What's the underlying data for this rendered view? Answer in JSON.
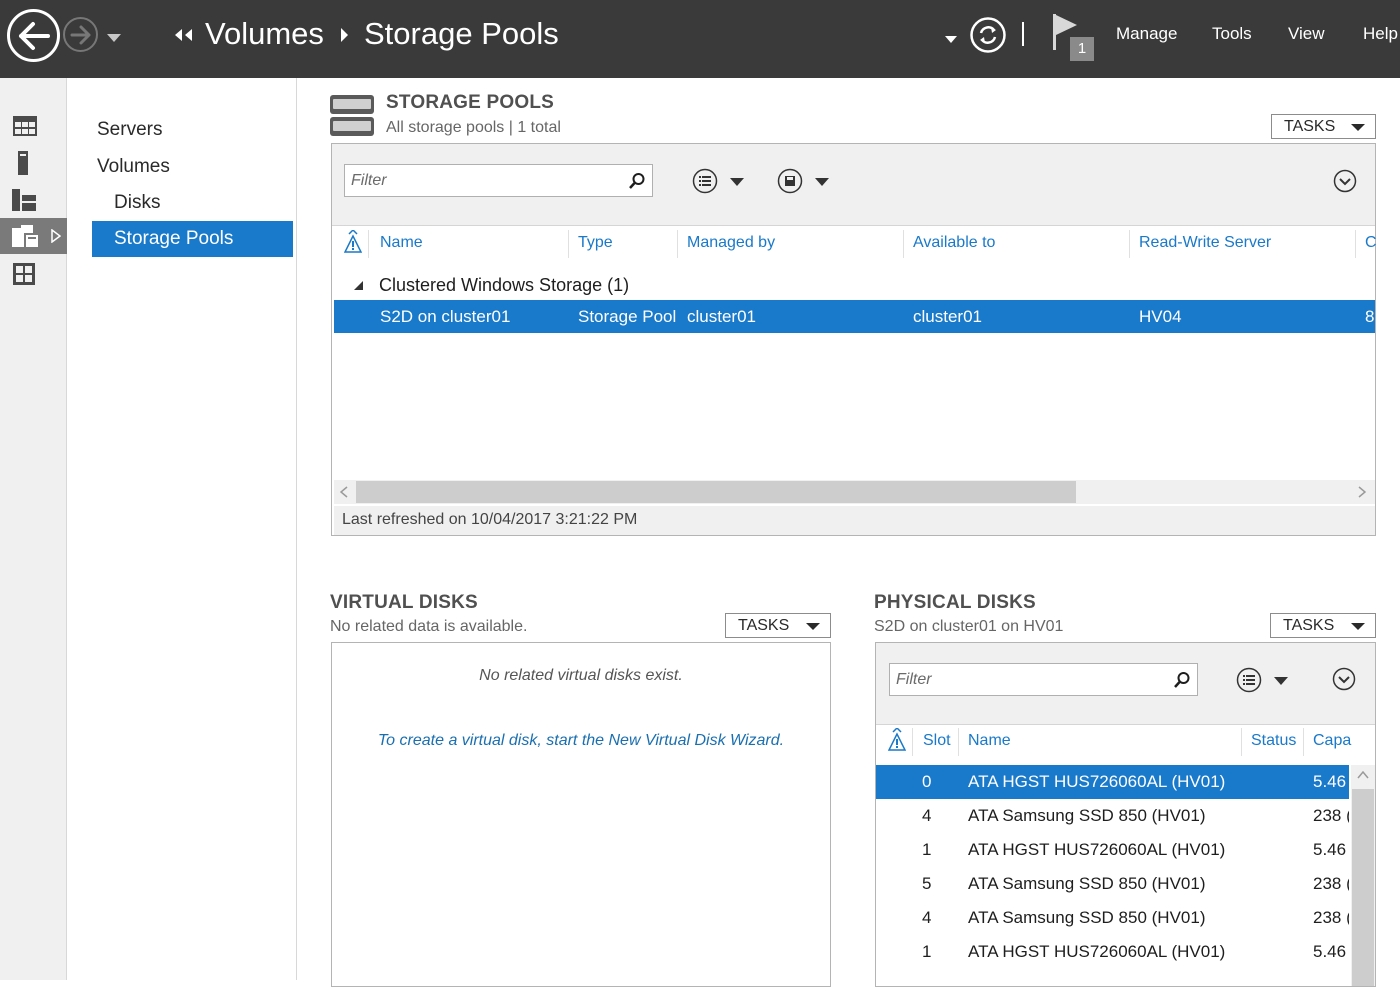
{
  "header": {
    "breadcrumb": [
      "Volumes",
      "Storage Pools"
    ],
    "notification_count": "1",
    "menu": [
      "Manage",
      "Tools",
      "View",
      "Help"
    ]
  },
  "tree": {
    "items": [
      "Servers",
      "Volumes",
      "Disks",
      "Storage Pools"
    ]
  },
  "storage_pools": {
    "title": "STORAGE POOLS",
    "subtitle": "All storage pools | 1 total",
    "tasks_label": "TASKS",
    "filter_placeholder": "Filter",
    "columns": [
      "Name",
      "Type",
      "Managed by",
      "Available to",
      "Read-Write Server",
      "C"
    ],
    "group_label": "Clustered Windows Storage (1)",
    "row": {
      "name": "S2D on cluster01",
      "type": "Storage Pool",
      "managed_by": "cluster01",
      "available_to": "cluster01",
      "rw_server": "HV04",
      "extra": "8"
    },
    "status": "Last refreshed on 10/04/2017 3:21:22 PM"
  },
  "virtual_disks": {
    "title": "VIRTUAL DISKS",
    "subtitle": "No related data is available.",
    "tasks_label": "TASKS",
    "empty_message": "No related virtual disks exist.",
    "wizard_link": "To create a virtual disk, start the New Virtual Disk Wizard."
  },
  "physical_disks": {
    "title": "PHYSICAL DISKS",
    "subtitle": "S2D on cluster01 on HV01",
    "tasks_label": "TASKS",
    "filter_placeholder": "Filter",
    "columns": [
      "Slot",
      "Name",
      "Status",
      "Capa"
    ],
    "rows": [
      {
        "slot": "0",
        "name": "ATA HGST HUS726060AL (HV01)",
        "capacity": "5.46"
      },
      {
        "slot": "4",
        "name": "ATA Samsung SSD 850 (HV01)",
        "capacity": "238 ("
      },
      {
        "slot": "1",
        "name": "ATA HGST HUS726060AL (HV01)",
        "capacity": "5.46 ¨"
      },
      {
        "slot": "5",
        "name": "ATA Samsung SSD 850 (HV01)",
        "capacity": "238 ("
      },
      {
        "slot": "4",
        "name": "ATA Samsung SSD 850 (HV01)",
        "capacity": "238 ("
      },
      {
        "slot": "1",
        "name": "ATA HGST HUS726060AL (HV01)",
        "capacity": "5.46 ¨"
      }
    ],
    "selected_index": 0
  },
  "colors": {
    "header_bg": "#3a3a3a",
    "accent": "#1979ca",
    "rail_bg": "#f0f0f0"
  }
}
